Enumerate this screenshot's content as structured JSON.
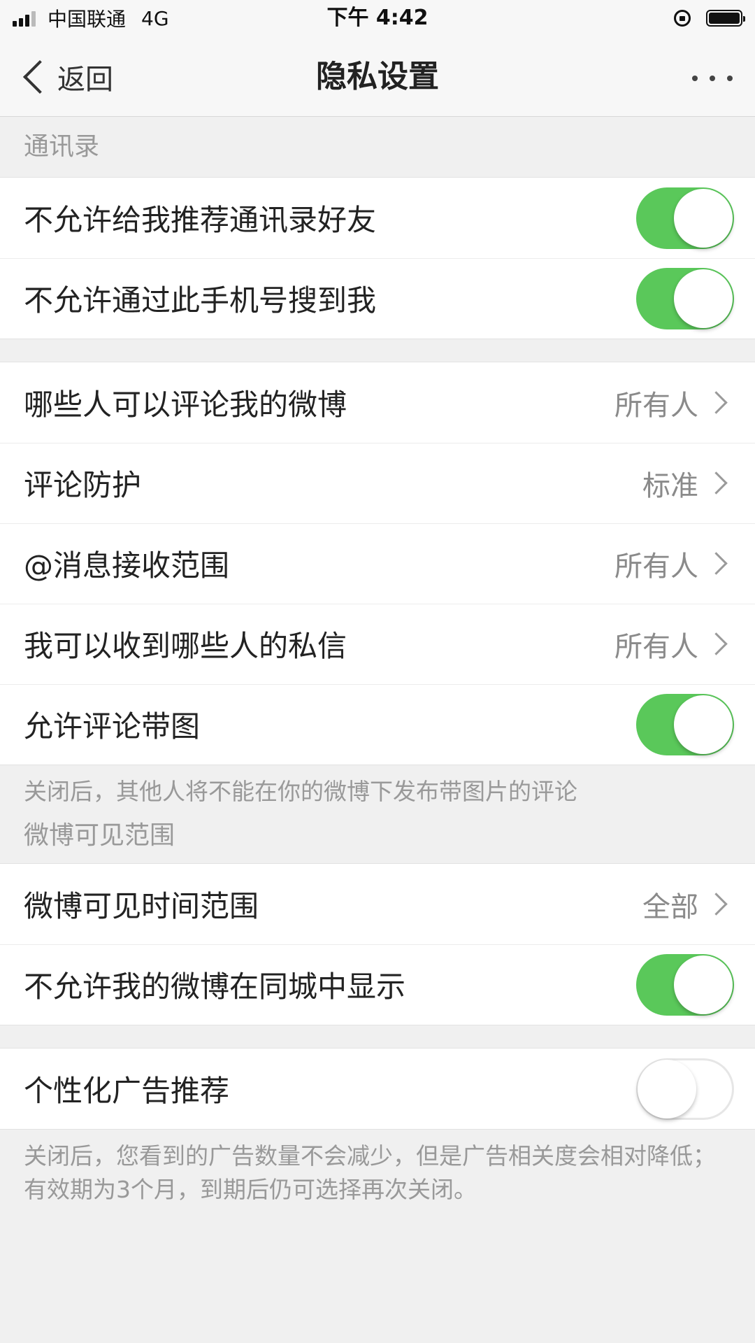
{
  "status_bar": {
    "carrier": "中国联通",
    "network": "4G",
    "time": "下午 4:42"
  },
  "nav": {
    "back_label": "返回",
    "title": "隐私设置"
  },
  "sections": {
    "contacts_header": "通讯录",
    "contacts_rows": [
      {
        "label": "不允许给我推荐通讯录好友",
        "toggle": true
      },
      {
        "label": "不允许通过此手机号搜到我",
        "toggle": true
      }
    ],
    "interaction_rows": [
      {
        "label": "哪些人可以评论我的微博",
        "value": "所有人"
      },
      {
        "label": "评论防护",
        "value": "标准"
      },
      {
        "label": "@消息接收范围",
        "value": "所有人"
      },
      {
        "label": "我可以收到哪些人的私信",
        "value": "所有人"
      },
      {
        "label": "允许评论带图",
        "toggle": true
      }
    ],
    "image_comment_note": "关闭后，其他人将不能在你的微博下发布带图片的评论",
    "visibility_header": "微博可见范围",
    "visibility_rows": [
      {
        "label": "微博可见时间范围",
        "value": "全部"
      },
      {
        "label": "不允许我的微博在同城中显示",
        "toggle": true
      }
    ],
    "ads_rows": [
      {
        "label": "个性化广告推荐",
        "toggle": false
      }
    ],
    "ads_note": "关闭后，您看到的广告数量不会减少，但是广告相关度会相对降低；有效期为3个月，到期后仍可选择再次关闭。"
  },
  "colors": {
    "toggle_on": "#5ac85a",
    "background": "#f0f0f0"
  }
}
